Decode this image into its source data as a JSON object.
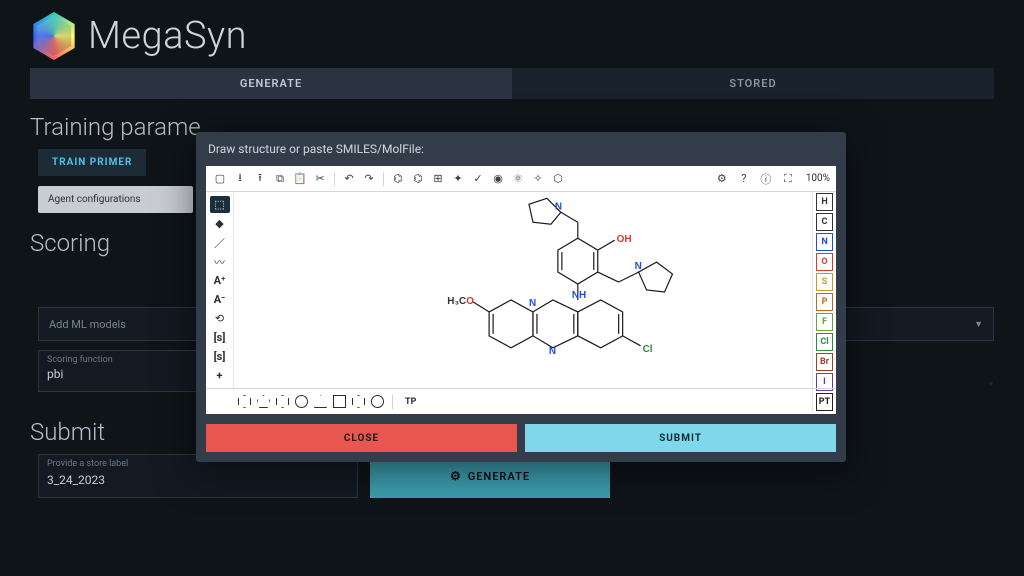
{
  "app": {
    "name": "MegaSyn"
  },
  "tabs": {
    "generate": "GENERATE",
    "stored": "STORED"
  },
  "sections": {
    "training": {
      "title": "Training parame",
      "train_primer": "TRAIN PRIMER",
      "agent_config": "Agent configurations"
    },
    "scoring": {
      "title": "Scoring",
      "add_ml": "Add ML models",
      "fn_label": "Scoring function",
      "fn_value": "pbi"
    },
    "submit": {
      "title": "Submit",
      "store_label": "Provide a store label",
      "store_value": "3_24_2023",
      "generate_btn": "GENERATE"
    }
  },
  "modal": {
    "title": "Draw structure or paste SMILES/MolFile:",
    "zoom": "100%",
    "close": "CLOSE",
    "submit": "SUBMIT",
    "elements": [
      {
        "sym": "H",
        "color": "#333"
      },
      {
        "sym": "C",
        "color": "#333"
      },
      {
        "sym": "N",
        "color": "#1f4fd8"
      },
      {
        "sym": "O",
        "color": "#d83a2a"
      },
      {
        "sym": "S",
        "color": "#c79a1a"
      },
      {
        "sym": "P",
        "color": "#c16a1a"
      },
      {
        "sym": "F",
        "color": "#6aa335"
      },
      {
        "sym": "Cl",
        "color": "#2d8c3f"
      },
      {
        "sym": "Br",
        "color": "#a33d2c"
      },
      {
        "sym": "I",
        "color": "#6b3aa0"
      },
      {
        "sym": "PT",
        "color": "#222"
      }
    ],
    "shape_tp": "TP",
    "structure_labels": {
      "oh": "OH",
      "n1": "N",
      "n2": "N",
      "n3": "N",
      "nh": "NH",
      "h3co": "H3CO",
      "cl": "Cl"
    },
    "structure_colors": {
      "O": "#d83a2a",
      "N": "#1f4fd8",
      "Cl": "#2d8c3f",
      "C": "#333"
    }
  }
}
